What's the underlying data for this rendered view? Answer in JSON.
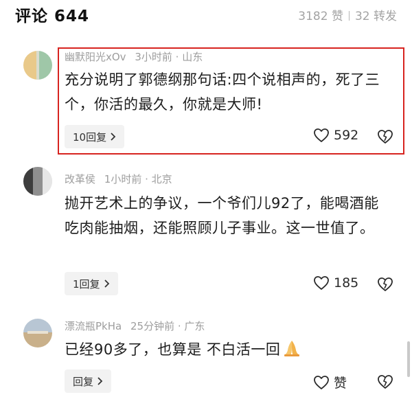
{
  "header": {
    "title": "评论 644",
    "likes": "3182 赞",
    "shares": "32 转发"
  },
  "comments": [
    {
      "username": "幽默阳光xOv",
      "time": "3小时前",
      "location": "山东",
      "text": "充分说明了郭德纲那句话:四个说相声的，死了三个，你活的最久，你就是大师!",
      "reply_label": "10回复",
      "like_count": "592"
    },
    {
      "username": "改革侯",
      "time": "1小时前",
      "location": "北京",
      "text": "抛开艺术上的争议，一个爷们儿92了，能喝酒能吃肉能抽烟，还能照顾儿子事业。这一世值了。",
      "reply_label": "1回复",
      "like_count": "185"
    },
    {
      "username": "漂流瓶PkHa",
      "time": "25分钟前",
      "location": "广东",
      "text": "已经90多了，也算是 不白活一回",
      "reply_label": "回复",
      "like_count": "赞"
    }
  ],
  "colors": {
    "highlight_border": "#d7231f",
    "meta_text": "#9d9d9d",
    "reply_bg": "#f2f2f2"
  },
  "icons": {
    "like": "heart-icon",
    "dislike": "broken-heart-icon",
    "reply_arrow": "chevron-right-icon",
    "emoji": "praying-hands-emoji"
  }
}
